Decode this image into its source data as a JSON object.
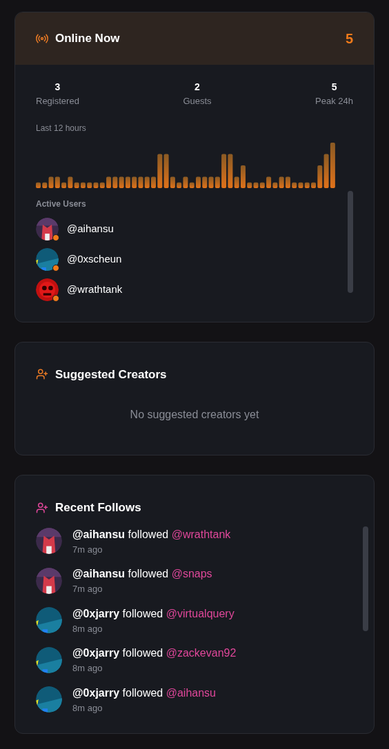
{
  "online_now": {
    "title": "Online Now",
    "count": "5",
    "stats": [
      {
        "value": "3",
        "label": "Registered"
      },
      {
        "value": "2",
        "label": "Guests"
      },
      {
        "value": "5",
        "label": "Peak 24h"
      }
    ],
    "activity_label": "Last 12 hours",
    "active_users_label": "Active Users",
    "active_users": [
      {
        "handle": "@aihansu",
        "online": true
      },
      {
        "handle": "@0xscheun",
        "online": true
      },
      {
        "handle": "@wrathtank",
        "online": true
      }
    ]
  },
  "suggested_creators": {
    "title": "Suggested Creators",
    "empty_text": "No suggested creators yet"
  },
  "recent_follows": {
    "title": "Recent Follows",
    "items": [
      {
        "follower": "@aihansu",
        "verb": "followed",
        "followed": "@wrathtank",
        "time": "7m ago"
      },
      {
        "follower": "@aihansu",
        "verb": "followed",
        "followed": "@snaps",
        "time": "7m ago"
      },
      {
        "follower": "@0xjarry",
        "verb": "followed",
        "followed": "@virtualquery",
        "time": "8m ago"
      },
      {
        "follower": "@0xjarry",
        "verb": "followed",
        "followed": "@zackevan92",
        "time": "8m ago"
      },
      {
        "follower": "@0xjarry",
        "verb": "followed",
        "followed": "@aihansu",
        "time": "8m ago"
      }
    ]
  }
}
